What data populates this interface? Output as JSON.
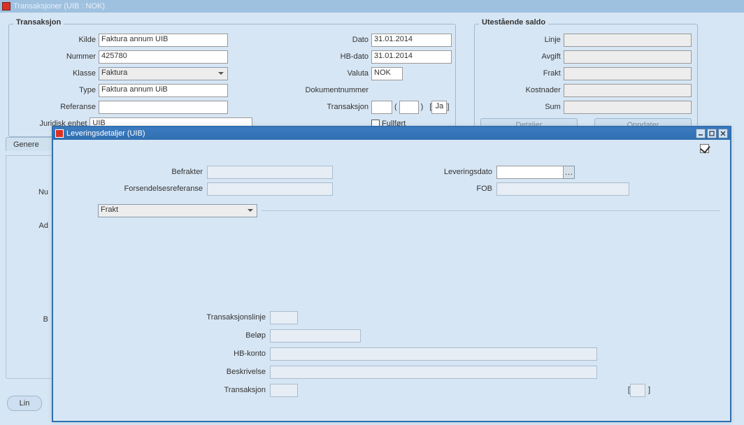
{
  "win1": {
    "title": "Transaksjoner (UIB : NOK)",
    "group_transaksjon": "Transaksjon",
    "kilde_lbl": "Kilde",
    "kilde": "Faktura annum UIB",
    "nummer_lbl": "Nummer",
    "nummer": "425780",
    "klasse_lbl": "Klasse",
    "klasse": "Faktura",
    "type_lbl": "Type",
    "type": "Faktura annum UiB",
    "referanse_lbl": "Referanse",
    "referanse": "",
    "juridisk_lbl": "Juridisk enhet",
    "juridisk": "UIB",
    "dato_lbl": "Dato",
    "dato": "31.01.2014",
    "hbdato_lbl": "HB-dato",
    "hbdato": "31.01.2014",
    "valuta_lbl": "Valuta",
    "valuta": "NOK",
    "doknr_lbl": "Dokumentnummer",
    "doknr": "",
    "trans_lbl": "Transaksjon",
    "trans1": "",
    "trans2": "",
    "trans_ja": "Ja",
    "fullfort_lbl": "Fullført",
    "group_saldo": "Utestående saldo",
    "linje_lbl": "Linje",
    "avgift_lbl": "Avgift",
    "frakt_lbl": "Frakt",
    "kostnader_lbl": "Kostnader",
    "sum_lbl": "Sum",
    "detaljer_btn": "Detaljer",
    "oppdater_btn": "Oppdater",
    "tab_genere": "Genere",
    "stub_nu": "Nu",
    "stub_ad": "Ad",
    "stub_b": "B",
    "linj_btn": "Lin"
  },
  "win2": {
    "title": "Leveringsdetaljer (UIB)",
    "befrakter_lbl": "Befrakter",
    "forsref_lbl": "Forsendelsesreferanse",
    "levdato_lbl": "Leveringsdato",
    "fob_lbl": "FOB",
    "frakt_combo": "Frakt",
    "translinje_lbl": "Transaksjonslinje",
    "belop_lbl": "Beløp",
    "hbkonto_lbl": "HB-konto",
    "beskrivelse_lbl": "Beskrivelse",
    "transaksjon_lbl": "Transaksjon",
    "datebtn": "…",
    "bracket_l": "[",
    "bracket_r": "]"
  }
}
